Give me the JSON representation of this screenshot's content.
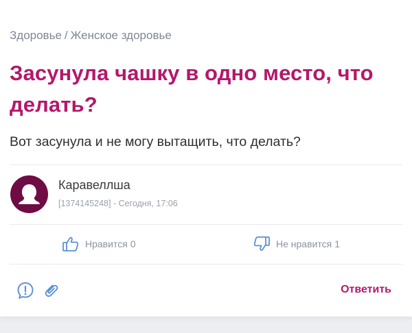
{
  "breadcrumb": {
    "category": "Здоровье",
    "separator": "/",
    "subcategory": "Женское здоровье"
  },
  "question": {
    "title": "Засунула чашку в одно место, что делать?",
    "body": "Вот засунула и не могу вытащить, что делать?"
  },
  "author": {
    "name": "Каравеллша",
    "meta": "[1374145248] - Сегодня, 17:06"
  },
  "votes": {
    "like_label": "Нравится",
    "like_count": "0",
    "dislike_label": "Не нравится",
    "dislike_count": "1"
  },
  "actions": {
    "reply_label": "Ответить"
  },
  "colors": {
    "accent": "#b5176b",
    "avatar_bg": "#6f0c43",
    "muted": "#8a93a0"
  },
  "icons": [
    "avatar-person-icon",
    "thumbs-up-icon",
    "thumbs-down-icon",
    "report-exclamation-icon",
    "link-paperclip-icon"
  ]
}
